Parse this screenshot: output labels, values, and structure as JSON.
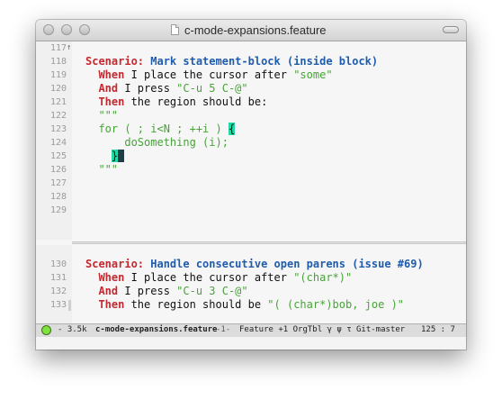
{
  "window": {
    "title": "c-mode-expansions.feature"
  },
  "top_pane": {
    "lines": [
      {
        "num": "117",
        "parts": []
      },
      {
        "num": "118",
        "parts": [
          {
            "t": "Scenario: ",
            "c": "kw"
          },
          {
            "t": "Mark statement-block (inside block)",
            "c": "title-txt"
          }
        ]
      },
      {
        "num": "119",
        "parts": [
          {
            "t": "  When ",
            "c": "step"
          },
          {
            "t": "I place the cursor after ",
            "c": "plain"
          },
          {
            "t": "\"some\"",
            "c": "str"
          }
        ]
      },
      {
        "num": "120",
        "parts": [
          {
            "t": "  And ",
            "c": "step"
          },
          {
            "t": "I press ",
            "c": "plain"
          },
          {
            "t": "\"C-u 5 C-@\"",
            "c": "str"
          }
        ]
      },
      {
        "num": "121",
        "parts": [
          {
            "t": "  Then ",
            "c": "step"
          },
          {
            "t": "the region should be:",
            "c": "plain"
          }
        ]
      },
      {
        "num": "122",
        "parts": [
          {
            "t": "  \"\"\"",
            "c": "docstr"
          }
        ]
      },
      {
        "num": "123",
        "parts": [
          {
            "t": "  for ( ; i<N ; ++i ) ",
            "c": "docstr"
          },
          {
            "t": "{",
            "c": "paren-hl"
          }
        ]
      },
      {
        "num": "124",
        "parts": [
          {
            "t": "      doSomething (i);",
            "c": "docstr"
          }
        ]
      },
      {
        "num": "125",
        "parts": [
          {
            "t": "    ",
            "c": "docstr"
          },
          {
            "t": "}",
            "c": "paren-hl"
          },
          {
            "t": " ",
            "c": "cursor"
          }
        ]
      },
      {
        "num": "126",
        "parts": [
          {
            "t": "  \"\"\"",
            "c": "docstr"
          }
        ]
      },
      {
        "num": "127",
        "parts": []
      },
      {
        "num": "128",
        "parts": []
      },
      {
        "num": "129",
        "parts": []
      }
    ]
  },
  "bottom_pane": {
    "lines": [
      {
        "num": "130",
        "parts": [
          {
            "t": "Scenario: ",
            "c": "kw"
          },
          {
            "t": "Handle consecutive open parens (issue #69)",
            "c": "title-txt"
          }
        ]
      },
      {
        "num": "131",
        "parts": [
          {
            "t": "  When ",
            "c": "step"
          },
          {
            "t": "I place the cursor after ",
            "c": "plain"
          },
          {
            "t": "\"(char*)\"",
            "c": "str"
          }
        ]
      },
      {
        "num": "132",
        "parts": [
          {
            "t": "  And ",
            "c": "step"
          },
          {
            "t": "I press ",
            "c": "plain"
          },
          {
            "t": "\"C-u 3 C-@\"",
            "c": "str"
          }
        ]
      },
      {
        "num": "133",
        "parts": [
          {
            "t": "  Then ",
            "c": "step"
          },
          {
            "t": "the region should be ",
            "c": "plain"
          },
          {
            "t": "\"( (char*)bob, joe )\"",
            "c": "str"
          }
        ]
      }
    ]
  },
  "modeline": {
    "size": "- 3.5k",
    "buffer": "c-mode-expansions.feature",
    "window_num": "-1-",
    "modes": "Feature +1 OrgTbl γ ψ τ",
    "vcs": "Git-master",
    "position": "125 :  7"
  },
  "colors": {
    "keyword": "#c5282f",
    "scenario_title": "#1f5cad",
    "string": "#48a339",
    "paren_highlight": "#24d8a6",
    "cursor": "#1e3d46"
  }
}
